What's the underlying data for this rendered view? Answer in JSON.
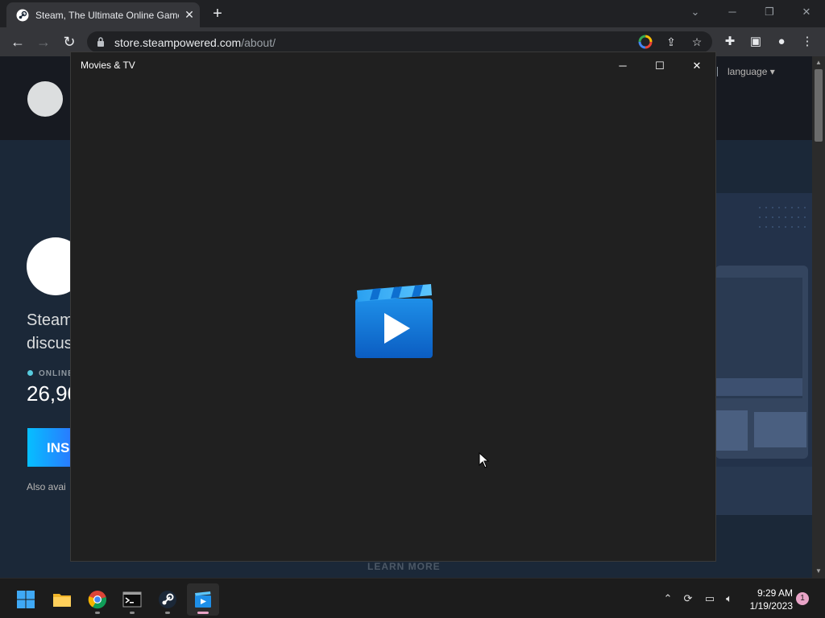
{
  "browser": {
    "tab_title": "Steam, The Ultimate Online Game Platform",
    "tab_close": "✕",
    "new_tab": "+",
    "url_host": "store.steampowered.com",
    "url_path": "/about/",
    "nav": {
      "back": "←",
      "forward": "→",
      "reload": "↻"
    },
    "icons": [
      "google-icon",
      "share-icon",
      "bookmark-star-icon",
      "extensions-icon",
      "side-panel-icon",
      "profile-icon",
      "menu-icon"
    ]
  },
  "steam_page": {
    "language_label": "language",
    "hero_line1": "Steam",
    "hero_line2": "discus",
    "online_label": "ONLINE",
    "online_count": "26,90",
    "install_label": "INS",
    "also_available": "Also avai",
    "learn_more": "LEARN MORE"
  },
  "movies_window": {
    "title": "Movies & TV",
    "minimize": "─",
    "maximize": "☐",
    "close": "✕"
  },
  "taskbar": {
    "apps": [
      "windows-start-icon",
      "file-explorer-icon",
      "chrome-icon",
      "terminal-icon",
      "steam-icon",
      "movies-tv-icon"
    ],
    "time": "9:29 AM",
    "date": "1/19/2023",
    "notification_count": "1"
  },
  "colors": {
    "steam_bg": "#1b2838",
    "accent_blue": "#06bfff",
    "window_bg": "#202020"
  }
}
